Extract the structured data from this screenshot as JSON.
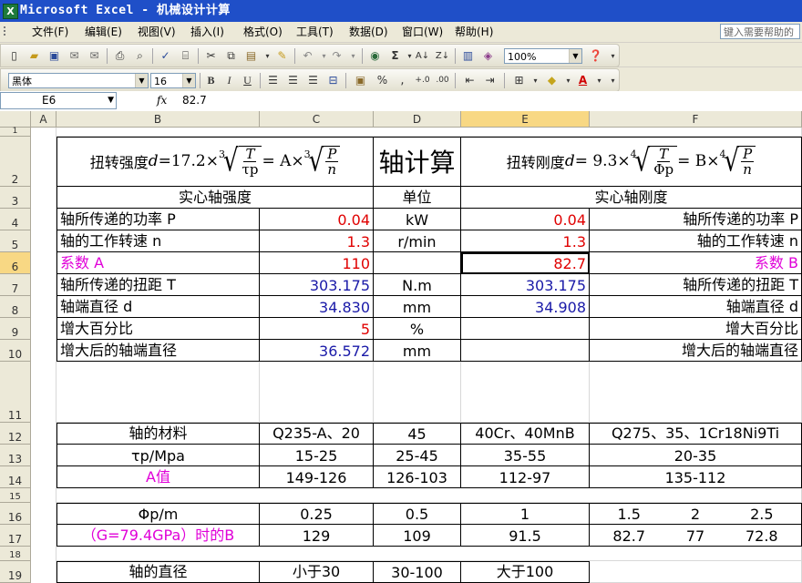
{
  "window": {
    "title": "Microsoft Excel - 机械设计计算",
    "app_icon": "excel-icon"
  },
  "menu": {
    "items": [
      "文件(F)",
      "编辑(E)",
      "视图(V)",
      "插入(I)",
      "格式(O)",
      "工具(T)",
      "数据(D)",
      "窗口(W)",
      "帮助(H)"
    ],
    "help_placeholder": "键入需要帮助的"
  },
  "toolbar": {
    "zoom": "100%",
    "font_name": "黑体",
    "font_size": "16"
  },
  "formula_bar": {
    "name_box": "E6",
    "fx_label": "fx",
    "value": "82.7"
  },
  "columns": [
    "A",
    "B",
    "C",
    "D",
    "E",
    "F"
  ],
  "rows": [
    "1",
    "2",
    "3",
    "4",
    "5",
    "6",
    "7",
    "8",
    "9",
    "10",
    "11",
    "12",
    "13",
    "14",
    "15",
    "16",
    "17",
    "18",
    "19"
  ],
  "sheet": {
    "r2": {
      "left_formula": {
        "label": "扭转强度",
        "lhs": "d",
        "eq": "=17.2×",
        "idx": "3",
        "num": "T",
        "den": "τp",
        "mid": "= A×",
        "idx2": "3",
        "num2": "P",
        "den2": "n"
      },
      "title": "轴计算",
      "right_formula": {
        "label": "扭转刚度",
        "lhs": "d",
        "eq": "= 9.3×",
        "idx": "4",
        "num": "T",
        "den": "Φp",
        "mid": "= B×",
        "idx2": "4",
        "num2": "P",
        "den2": "n"
      }
    },
    "r3": {
      "left": "实心轴强度",
      "unit": "单位",
      "right": "实心轴刚度"
    },
    "r4": {
      "b": "轴所传递的功率 P",
      "c": "0.04",
      "d": "kW",
      "e": "0.04",
      "f": "轴所传递的功率 P"
    },
    "r5": {
      "b": "轴的工作转速 n",
      "c": "1.3",
      "d": "r/min",
      "e": "1.3",
      "f": "轴的工作转速 n"
    },
    "r6": {
      "b": "系数 A",
      "c": "110",
      "d": "",
      "e": "82.7",
      "f": "系数 B"
    },
    "r7": {
      "b": "轴所传递的扭距 T",
      "c": "303.175",
      "d": "N.m",
      "e": "303.175",
      "f": "轴所传递的扭距 T"
    },
    "r8": {
      "b": "轴端直径 d",
      "c": "34.830",
      "d": "mm",
      "e": "34.908",
      "f": "轴端直径 d"
    },
    "r9": {
      "b": "增大百分比",
      "c": "5",
      "d": "%",
      "e": "",
      "f": "增大百分比"
    },
    "r10": {
      "b": "增大后的轴端直径",
      "c": "36.572",
      "d": "mm",
      "e": "",
      "f": "增大后的轴端直径"
    },
    "r12": {
      "b": "轴的材料",
      "c": "Q235-A、20",
      "d": "45",
      "e": "40Cr、40MnB",
      "f": "Q275、35、1Cr18Ni9Ti"
    },
    "r13": {
      "b": "τp/Mpa",
      "c": "15-25",
      "d": "25-45",
      "e": "35-55",
      "f": "20-35"
    },
    "r14": {
      "b": "A值",
      "c": "149-126",
      "d": "126-103",
      "e": "112-97",
      "f": "135-112"
    },
    "r16": {
      "b": "Φp/m",
      "c": "0.25",
      "d": "0.5",
      "e": "1",
      "f1": "1.5",
      "f2": "2",
      "f3": "2.5"
    },
    "r17": {
      "b": "（G=79.4GPa）时的B",
      "c": "129",
      "d": "109",
      "e": "91.5",
      "f1": "82.7",
      "f2": "77",
      "f3": "72.8"
    },
    "r19": {
      "b": "轴的直径",
      "c": "小于30",
      "d": "30-100",
      "e": "大于100"
    }
  },
  "colors": {
    "title_bar": "#1f4fc8",
    "input_red": "#e00000",
    "value_blue": "#1a1aa8",
    "label_magenta": "#e000d8",
    "selected_header": "#f8d884"
  }
}
